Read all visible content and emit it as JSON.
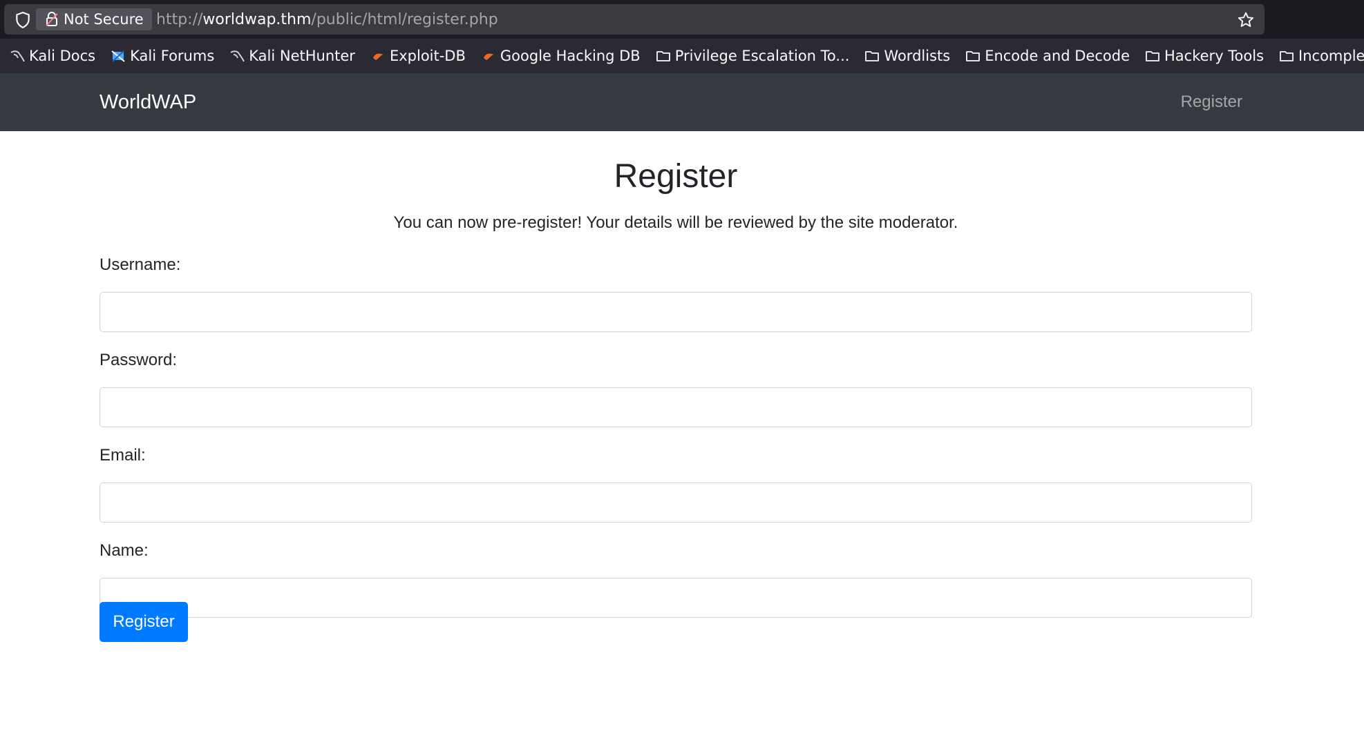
{
  "browser": {
    "security_label": "Not Secure",
    "url_prefix": "http://",
    "url_host": "worldwap.thm",
    "url_path": "/public/html/register.php",
    "bookmarks": [
      {
        "label": "Kali Docs",
        "icon": "kali-dragon-icon"
      },
      {
        "label": "Kali Forums",
        "icon": "kali-forums-icon"
      },
      {
        "label": "Kali NetHunter",
        "icon": "kali-dragon-icon"
      },
      {
        "label": "Exploit-DB",
        "icon": "exploitdb-icon"
      },
      {
        "label": "Google Hacking DB",
        "icon": "exploitdb-icon"
      },
      {
        "label": "Privilege Escalation To...",
        "icon": "folder-icon"
      },
      {
        "label": "Wordlists",
        "icon": "folder-icon"
      },
      {
        "label": "Encode and Decode",
        "icon": "folder-icon"
      },
      {
        "label": "Hackery Tools",
        "icon": "folder-icon"
      },
      {
        "label": "Incomplete Lab W",
        "icon": "folder-icon"
      }
    ]
  },
  "navbar": {
    "brand": "WorldWAP",
    "link": "Register"
  },
  "page": {
    "title": "Register",
    "lead": "You can now pre-register! Your details will be reviewed by the site moderator.",
    "fields": [
      {
        "label": "Username:",
        "value": ""
      },
      {
        "label": "Password:",
        "value": ""
      },
      {
        "label": "Email:",
        "value": ""
      },
      {
        "label": "Name:",
        "value": ""
      }
    ],
    "submit_label": "Register"
  },
  "colors": {
    "navbar_bg": "#343a40",
    "primary": "#007bff",
    "browser_bg": "#1c1b22",
    "bookmarks_bg": "#2b2a33"
  }
}
